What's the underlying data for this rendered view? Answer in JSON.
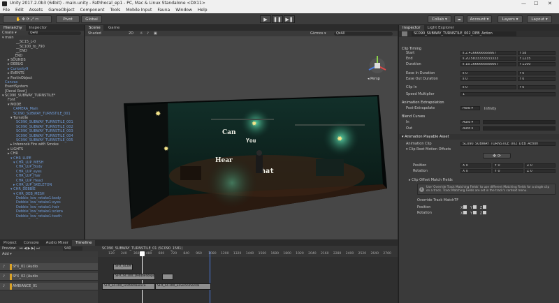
{
  "window": {
    "title": "Unity 2017.2.0b3 (64bit) - main.unity - Fathhocal_ep1 - PC, Mac & Linux Standalone <DX11>",
    "minimize": "—",
    "maximize": "☐",
    "close": "✕"
  },
  "menu": [
    "File",
    "Edit",
    "Assets",
    "GameObject",
    "Component",
    "Tools",
    "Mobile Input",
    "Fauna",
    "Window",
    "Help"
  ],
  "toolbar": {
    "pivot": "Pivot",
    "global": "Global",
    "play": "▶",
    "pause": "❚❚",
    "step": "▶❚",
    "collab": "Collab ▾",
    "account": "Account ▾",
    "layers": "Layers ▾",
    "layout": "Layout ▾"
  },
  "hierarchy": {
    "tabs": [
      "Hierarchy",
      "Inspector"
    ],
    "create": "Create ▾",
    "search_placeholder": "Q▾All",
    "rows": [
      {
        "text": "▾ main",
        "blue": false,
        "indent": 0
      },
      {
        "text": "__SC15_L-0",
        "blue": false,
        "indent": 5
      },
      {
        "text": "__SC100_to_790",
        "blue": false,
        "indent": 5
      },
      {
        "text": "__END",
        "blue": false,
        "indent": 5
      },
      {
        "text": "_END",
        "blue": false,
        "indent": 4
      },
      {
        "text": "▸ SOUNDS",
        "blue": false,
        "indent": 2
      },
      {
        "text": "▸ DEBUG",
        "blue": false,
        "indent": 2
      },
      {
        "text": "▸ Curiosity9",
        "blue": true,
        "indent": 2
      },
      {
        "text": "▸ EVENTS",
        "blue": false,
        "indent": 2
      },
      {
        "text": "▸ FestinObject",
        "blue": false,
        "indent": 2
      },
      {
        "text": "Canvas",
        "blue": true,
        "indent": 1
      },
      {
        "text": "EventSystem",
        "blue": false,
        "indent": 1
      },
      {
        "text": "[Decal Root]",
        "blue": false,
        "indent": 1
      },
      {
        "text": "▾ SC090_SUBWAY_TURNSTILE*",
        "blue": false,
        "indent": 0
      },
      {
        "text": "Font",
        "blue": false,
        "indent": 2
      },
      {
        "text": "▾ MODE",
        "blue": false,
        "indent": 2
      },
      {
        "text": "CAMERA_Main",
        "blue": true,
        "indent": 4
      },
      {
        "text": "SC090_SUBWAY_TURNSTILE_001",
        "blue": true,
        "indent": 4
      },
      {
        "text": "▾ Turnstile",
        "blue": false,
        "indent": 3
      },
      {
        "text": "SC090_SUBWAY_TURNSTILE_001",
        "blue": true,
        "indent": 5
      },
      {
        "text": "SC090_SUBWAY_TURNSTILE_002",
        "blue": true,
        "indent": 5
      },
      {
        "text": "SC090_SUBWAY_TURNSTILE_003",
        "blue": true,
        "indent": 5
      },
      {
        "text": "SC090_SUBWAY_TURNSTILE_004",
        "blue": true,
        "indent": 5
      },
      {
        "text": "SC090_SUBWAY_TURNSTILE_005",
        "blue": true,
        "indent": 5
      },
      {
        "text": "▸ Inference Fire with Smoke",
        "blue": false,
        "indent": 3
      },
      {
        "text": "▸ LIGHTS",
        "blue": false,
        "indent": 2
      },
      {
        "text": "▸ CHR",
        "blue": false,
        "indent": 2
      },
      {
        "text": "▾ CHR_LUPE",
        "blue": true,
        "indent": 3
      },
      {
        "text": "▾ CHR_LUP_MESH",
        "blue": true,
        "indent": 4
      },
      {
        "text": "CHR_LUP_Body",
        "blue": true,
        "indent": 5
      },
      {
        "text": "CHR_LUP_eyes",
        "blue": true,
        "indent": 5
      },
      {
        "text": "CHR_LUP_Hair",
        "blue": true,
        "indent": 5
      },
      {
        "text": "CHR_LUP_Head",
        "blue": true,
        "indent": 5
      },
      {
        "text": "▸ CHR_LUP_SKELETON",
        "blue": true,
        "indent": 4
      },
      {
        "text": "▾ CHR_DEBBIE",
        "blue": true,
        "indent": 3
      },
      {
        "text": "▾ CHR_DEB_MESH",
        "blue": true,
        "indent": 4
      },
      {
        "text": "Debbie_low_retake1:body",
        "blue": true,
        "indent": 5
      },
      {
        "text": "Debbie_low_retake1:eyes",
        "blue": true,
        "indent": 5
      },
      {
        "text": "Debbie_low_retake1:hair",
        "blue": true,
        "indent": 5
      },
      {
        "text": "Debbie_low_retake1:sclera",
        "blue": true,
        "indent": 5
      },
      {
        "text": "Debbie_low_retake1:teeth",
        "blue": true,
        "indent": 5
      }
    ]
  },
  "scene": {
    "tabs": [
      "Scene",
      "Game"
    ],
    "shaded": "Shaded",
    "mode2d": "2D",
    "gizmos": "Gizmos ▾",
    "search": "Q▾All",
    "persp": "◂ Persp",
    "sign_words": [
      "Can",
      "You",
      "Hear",
      "Chat"
    ]
  },
  "inspector": {
    "tabs": [
      "Inspector",
      "Light Explorer"
    ],
    "clip_name": "SC090_SUBWAY_TURNSTILE_002_DEB_Action",
    "clip_timing": "Clip Timing",
    "start_label": "Start",
    "start_s": "s  2.4166666666667",
    "start_f": "f  58",
    "end_label": "End",
    "end_s": "s  20.5833333333333",
    "end_f": "f  1235",
    "duration_label": "Duration",
    "duration_s": "s  18.1666666666667",
    "duration_f": "f  1100",
    "ease_in_label": "Ease In Duration",
    "ease_in_s": "s  0",
    "ease_in_f": "f  0",
    "ease_out_label": "Ease Out Duration",
    "ease_out_s": "s  0",
    "ease_out_f": "f  0",
    "clip_in_label": "Clip In",
    "clip_in_s": "s  0",
    "clip_in_f": "f  0",
    "speed_label": "Speed Multiplier",
    "speed_value": "1",
    "anim_extrap": "Animation Extrapolation",
    "post_extrap_label": "Post-Extrapolate",
    "post_extrap_value": "Hold ▾",
    "post_extrap_infinity": "Infinity",
    "blend_curves": "Blend Curves",
    "in_label": "In",
    "in_value": "Auto ▾",
    "out_label": "Out",
    "out_value": "Auto ▾",
    "playable_asset": "▾ Animation Playable Asset",
    "anim_clip_label": "Animation Clip",
    "anim_clip_value": "SC090_SUBWAY_TURNSTILE_002_DEB_Action",
    "clip_root_motion": "▾ Clip Root Motion Offsets",
    "position_label": "Position",
    "rotation_label": "Rotation",
    "vec_x": "X 0",
    "vec_y": "Y 0",
    "vec_z": "Z 0",
    "clip_offset_match": "▸ Clip Offset Match Fields",
    "override_note": "Use 'Override Track Matching Fields' to use different Matching Fields for a single clip on a track. Track Matching Fields are set in the track's context menu.",
    "override_label": "Override Track MatchTF",
    "match_position": "Position",
    "match_rotation": "Rotation",
    "check_x": "X",
    "check_y": "Y",
    "check_z": "Z"
  },
  "timeline": {
    "tabs": [
      "Project",
      "Console",
      "Audio Mixer",
      "Timeline"
    ],
    "preview": "Preview",
    "frame_box": "940",
    "asset_name": "SC090_SUBWAY_TURNSTILE_01 (SC090_1581)",
    "add_button": "Add ▾",
    "ruler": [
      "120",
      "240",
      "360",
      "480",
      "600",
      "720",
      "840",
      "960",
      "1080",
      "1200",
      "1320",
      "1440",
      "1560",
      "1680",
      "1800",
      "1920",
      "2040",
      "2160",
      "2280",
      "2400",
      "2520",
      "2640",
      "2760"
    ],
    "tracks": [
      {
        "name": "SFX_01 (Audio",
        "bar_color": "#d9a227"
      },
      {
        "name": "SFX_02 (Audio",
        "bar_color": "#d9a227"
      },
      {
        "name": "AMBIANCE_01",
        "bar_color": "#d9a227"
      }
    ],
    "clips": [
      "SFX_SC09",
      "SFX_SC100_DebbieSteps",
      "SFX_SC100_FirstAmbience",
      "SFX_SC100_Environmental"
    ],
    "accent": "#e0a020"
  }
}
